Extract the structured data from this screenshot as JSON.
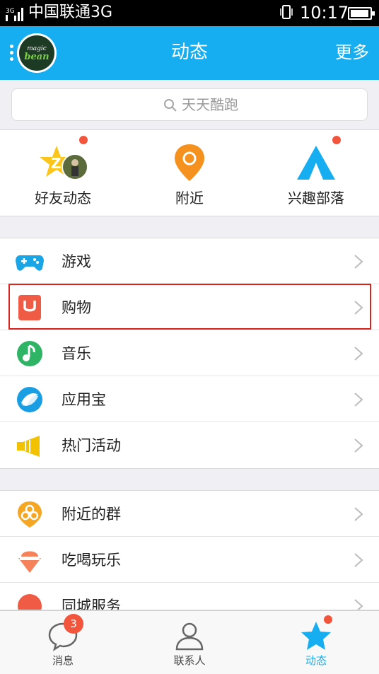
{
  "status_bar": {
    "carrier": "中国联通3G",
    "time": "10:17",
    "network_badge": "3G"
  },
  "nav": {
    "title": "动态",
    "more": "更多",
    "avatar_text_top": "magic",
    "avatar_text_bottom": "bean"
  },
  "search": {
    "placeholder": "天天酷跑"
  },
  "quick": [
    {
      "label": "好友动态",
      "icon": "friend-feed-icon",
      "has_dot": true
    },
    {
      "label": "附近",
      "icon": "location-pin-icon",
      "has_dot": false
    },
    {
      "label": "兴趣部落",
      "icon": "tent-icon",
      "has_dot": true
    }
  ],
  "group1": [
    {
      "label": "游戏",
      "icon": "gamepad-icon"
    },
    {
      "label": "购物",
      "icon": "shopping-icon"
    },
    {
      "label": "音乐",
      "icon": "music-note-icon"
    },
    {
      "label": "应用宝",
      "icon": "app-store-icon"
    },
    {
      "label": "热门活动",
      "icon": "megaphone-icon"
    }
  ],
  "group2": [
    {
      "label": "附近的群",
      "icon": "nearby-group-icon"
    },
    {
      "label": "吃喝玩乐",
      "icon": "food-icon"
    },
    {
      "label": "同城服务",
      "icon": "city-service-icon"
    }
  ],
  "tabs": [
    {
      "label": "消息",
      "icon": "chat-bubble-icon",
      "badge": "3",
      "active": false
    },
    {
      "label": "联系人",
      "icon": "contacts-icon",
      "active": false
    },
    {
      "label": "动态",
      "icon": "star-icon",
      "active": true,
      "has_dot": true
    }
  ],
  "colors": {
    "brand": "#16aef0",
    "badge": "#f2553b",
    "highlight": "#d9251d"
  }
}
